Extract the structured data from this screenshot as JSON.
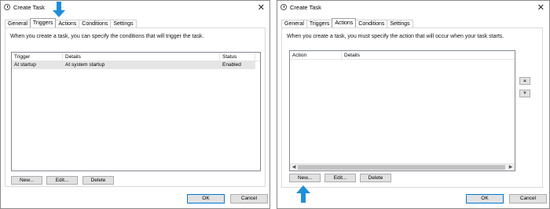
{
  "left_window": {
    "title": "Create Task",
    "close_glyph": "✕",
    "tabs": [
      "General",
      "Triggers",
      "Actions",
      "Conditions",
      "Settings"
    ],
    "active_tab": "Triggers",
    "description": "When you create a task, you can specify the conditions that will trigger the task.",
    "columns": [
      "Trigger",
      "Details",
      "Status"
    ],
    "rows": [
      {
        "trigger": "At startup",
        "details": "At system startup",
        "status": "Enabled"
      }
    ],
    "buttons": {
      "new": "New...",
      "edit": "Edit...",
      "delete": "Delete"
    },
    "ok_label": "OK",
    "cancel_label": "Cancel"
  },
  "right_window": {
    "title": "Create Task",
    "close_glyph": "✕",
    "tabs": [
      "General",
      "Triggers",
      "Actions",
      "Conditions",
      "Settings"
    ],
    "active_tab": "Actions",
    "description": "When you create a task, you must specify the action that will occur when your task starts.",
    "columns": [
      "Action",
      "Details"
    ],
    "rows": [],
    "buttons": {
      "new": "New...",
      "edit": "Edit...",
      "delete": "Delete"
    },
    "move_up_glyph": "▲",
    "move_down_glyph": "▼",
    "scroll_left_glyph": "◀",
    "scroll_right_glyph": "▶",
    "ok_label": "OK",
    "cancel_label": "Cancel"
  },
  "annotations": {
    "arrow_color": "#1e8fd8",
    "arrow_down_icon": "arrow-down-icon",
    "arrow_up_icon": "arrow-up-icon"
  }
}
